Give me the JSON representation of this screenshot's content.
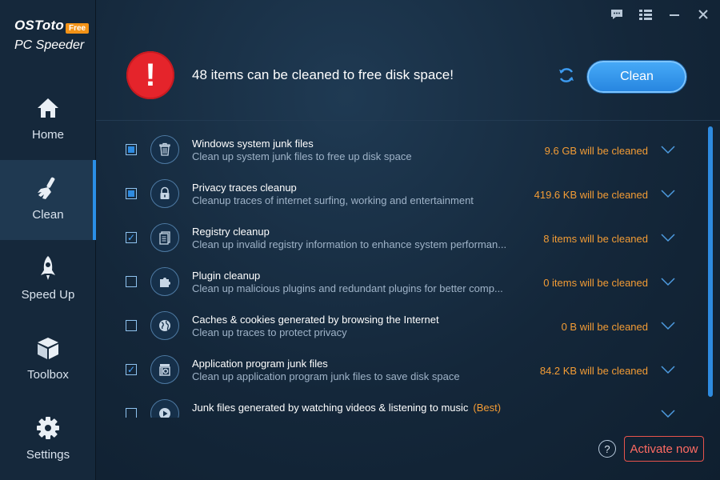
{
  "brand": {
    "name": "OSToto",
    "badge": "Free",
    "subtitle": "PC Speeder"
  },
  "sidebar": {
    "items": [
      {
        "label": "Home",
        "icon": "home-icon"
      },
      {
        "label": "Clean",
        "icon": "brush-icon",
        "active": true
      },
      {
        "label": "Speed Up",
        "icon": "rocket-icon"
      },
      {
        "label": "Toolbox",
        "icon": "box-icon"
      },
      {
        "label": "Settings",
        "icon": "gear-icon"
      }
    ]
  },
  "titlebar": {
    "icons": [
      "feedback-icon",
      "menu-icon",
      "minimize-icon",
      "close-icon"
    ]
  },
  "header": {
    "headline": "48 items can be cleaned to free disk space!",
    "clean_label": "Clean"
  },
  "items": [
    {
      "title": "Windows system junk files",
      "desc": "Clean up system junk files to free up disk space",
      "size": "9.6 GB will be cleaned",
      "state": "partial",
      "icon": "trash-icon"
    },
    {
      "title": "Privacy traces cleanup",
      "desc": "Cleanup traces of internet surfing, working and entertainment",
      "size": "419.6 KB will be cleaned",
      "state": "partial",
      "icon": "lock-icon"
    },
    {
      "title": "Registry cleanup",
      "desc": "Clean up invalid registry information to enhance system performan...",
      "size": "8 items will be cleaned",
      "state": "checked",
      "icon": "registry-icon"
    },
    {
      "title": "Plugin cleanup",
      "desc": "Clean up malicious plugins and redundant plugins for better comp...",
      "size": "0 items will be cleaned",
      "state": "unchecked",
      "icon": "puzzle-icon"
    },
    {
      "title": "Caches & cookies generated by browsing the Internet",
      "desc": "Clean up traces to protect privacy",
      "size": "0 B will be cleaned",
      "state": "unchecked",
      "icon": "globe-icon"
    },
    {
      "title": "Application program junk files",
      "desc": "Clean up application program junk files to save disk space",
      "size": "84.2 KB will be cleaned",
      "state": "checked",
      "icon": "app-junk-icon"
    },
    {
      "title": "Junk files generated by watching videos & listening to music",
      "best": "(Best)",
      "desc": "",
      "size": "",
      "state": "unchecked",
      "icon": "play-icon"
    }
  ],
  "footer": {
    "help_label": "?",
    "activate_label": "Activate now"
  },
  "colors": {
    "accent": "#2e8be0",
    "warning": "#f39c35",
    "alert": "#e5242b",
    "activate": "#ff6b63"
  }
}
